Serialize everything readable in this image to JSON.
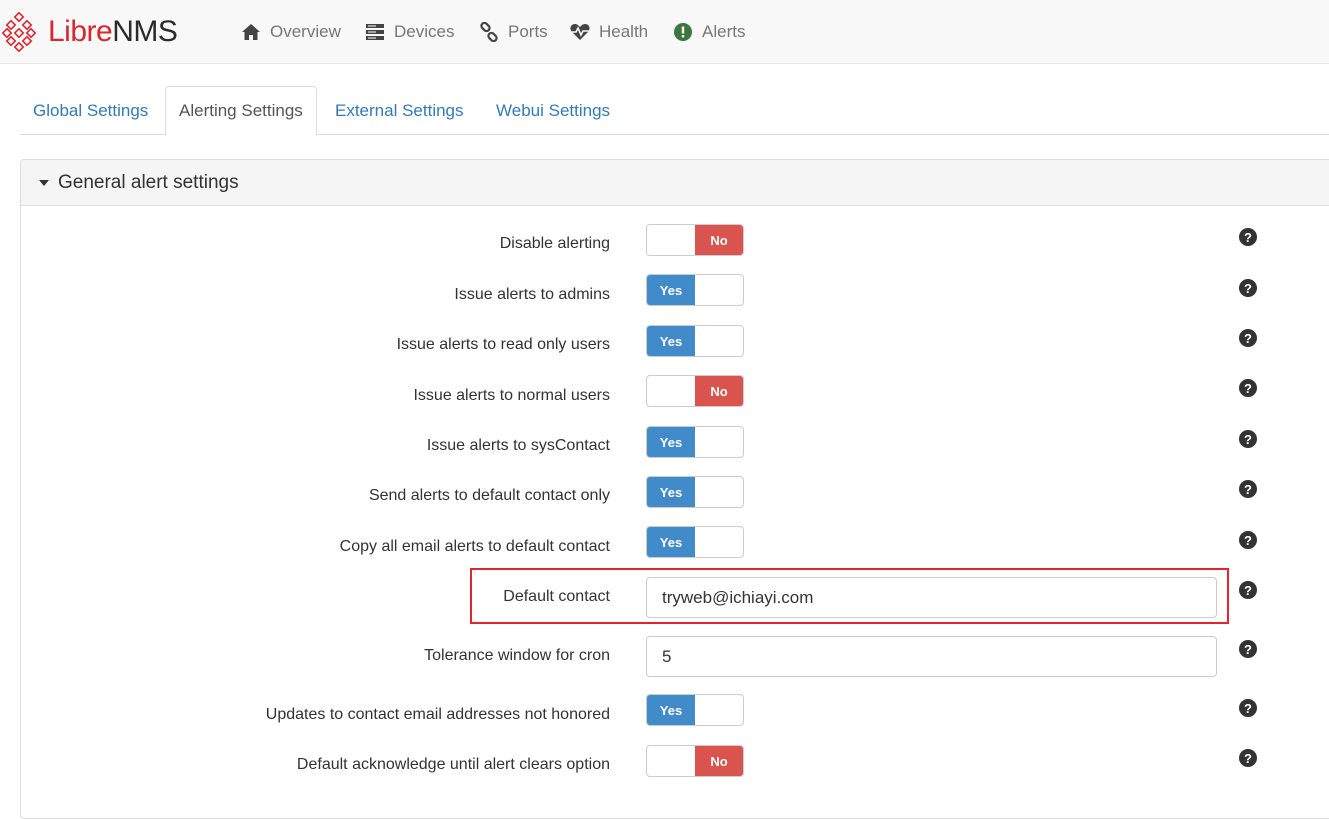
{
  "brand": {
    "libre": "Libre",
    "nms": "NMS"
  },
  "nav": [
    {
      "label": "Overview",
      "icon": "home-icon"
    },
    {
      "label": "Devices",
      "icon": "server-icon"
    },
    {
      "label": "Ports",
      "icon": "link-icon"
    },
    {
      "label": "Health",
      "icon": "heartbeat-icon"
    },
    {
      "label": "Alerts",
      "icon": "alert-circle-icon"
    }
  ],
  "tabs": [
    {
      "label": "Global Settings",
      "active": false
    },
    {
      "label": "Alerting Settings",
      "active": true
    },
    {
      "label": "External Settings",
      "active": false
    },
    {
      "label": "Webui Settings",
      "active": false
    }
  ],
  "panel": {
    "title": "General alert settings"
  },
  "settings": [
    {
      "label": "Disable alerting",
      "type": "switch",
      "value": "No"
    },
    {
      "label": "Issue alerts to admins",
      "type": "switch",
      "value": "Yes"
    },
    {
      "label": "Issue alerts to read only users",
      "type": "switch",
      "value": "Yes"
    },
    {
      "label": "Issue alerts to normal users",
      "type": "switch",
      "value": "No"
    },
    {
      "label": "Issue alerts to sysContact",
      "type": "switch",
      "value": "Yes"
    },
    {
      "label": "Send alerts to default contact only",
      "type": "switch",
      "value": "Yes"
    },
    {
      "label": "Copy all email alerts to default contact",
      "type": "switch",
      "value": "Yes"
    },
    {
      "label": "Default contact",
      "type": "text",
      "value": "tryweb@ichiayi.com"
    },
    {
      "label": "Tolerance window for cron",
      "type": "text",
      "value": "5"
    },
    {
      "label": "Updates to contact email addresses not honored",
      "type": "switch",
      "value": "Yes"
    },
    {
      "label": "Default acknowledge until alert clears option",
      "type": "switch",
      "value": "No"
    }
  ],
  "help_glyph": "?",
  "colors": {
    "yes": "#428bca",
    "no": "#d9534f",
    "link": "#337ab7",
    "highlight": "#e3232f",
    "brand_red": "#d9272e"
  }
}
